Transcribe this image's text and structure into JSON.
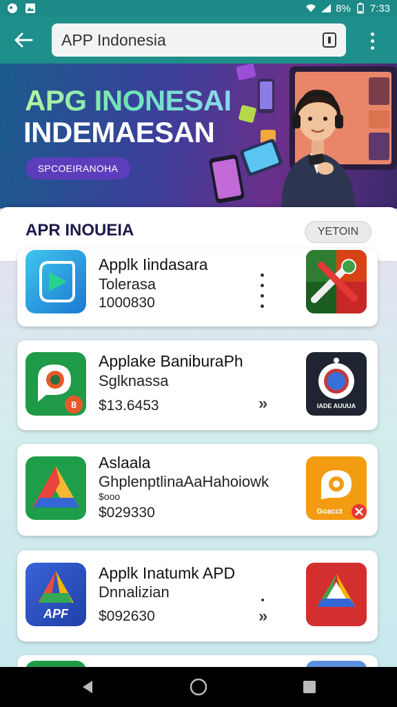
{
  "status_bar": {
    "battery": "8%",
    "time": "7:33"
  },
  "app_bar": {
    "search_query": "APP Indonesia"
  },
  "hero": {
    "title_line1": "APG INONESAI",
    "title_line2": "INDEMAESAN",
    "pill_label": "SPCOEIRANOHA"
  },
  "section": {
    "title": "APR INOUEIA",
    "button_label": "YETOIN"
  },
  "apps": [
    {
      "name": "Applk Iindasara",
      "subtitle": "Tolerasa",
      "meta": "1000830"
    },
    {
      "name": "Applake BaniburaPh",
      "subtitle": "Sglknassa",
      "meta": "$13.6453",
      "badge": "8"
    },
    {
      "name": "Aslaala",
      "subtitle": "GhplenptlinaAaHahoiowk",
      "aux": "$ooo",
      "meta": "$029330"
    },
    {
      "name": "Applk Inatumk APD",
      "subtitle": "Dnnalizian",
      "meta": "$092630",
      "icon_text": "APF"
    }
  ],
  "thumbs": {
    "card2_caption": "IADE AUUUA",
    "card3_caption": "Goacct"
  },
  "colors": {
    "status_bar": "#1c8a86",
    "app_bar": "#1e8f8a",
    "hero_pill": "#5c3dbb",
    "section_title": "#1d1a4a"
  }
}
